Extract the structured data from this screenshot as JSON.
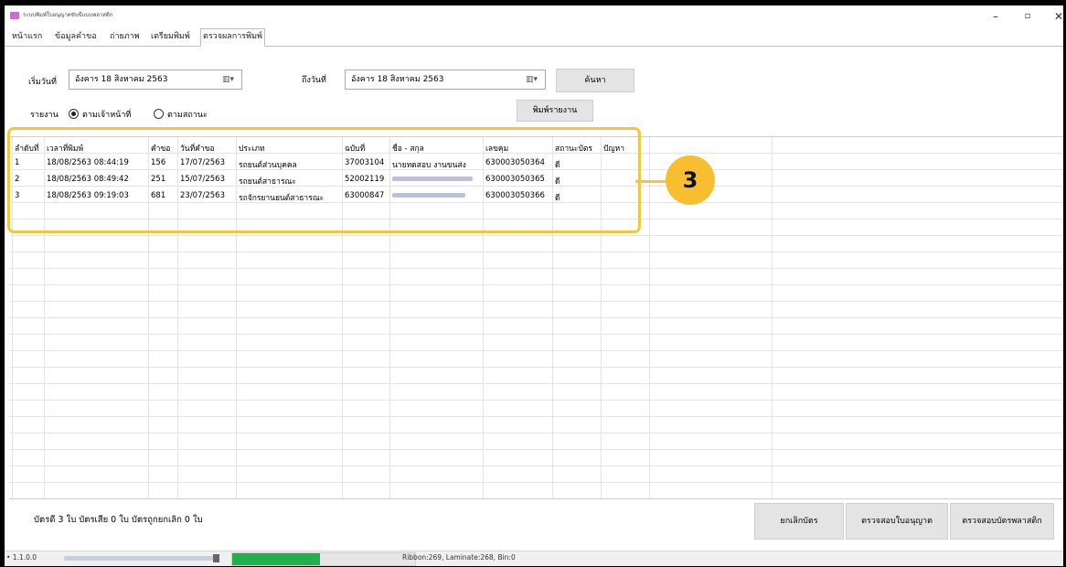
{
  "window": {
    "title": "ระบบพิมพ์ใบอนุญาตขับขี่แบบพลาสติก",
    "controls": {
      "minimize": "–",
      "maximize": "▫",
      "close": "✕"
    }
  },
  "tabs": [
    {
      "label": "หน้าแรก"
    },
    {
      "label": "ข้อมูลคำขอ"
    },
    {
      "label": "ถ่ายภาพ"
    },
    {
      "label": "เตรียมพิมพ์"
    },
    {
      "label": "ตรวจผลการพิมพ์",
      "active": true
    }
  ],
  "filters": {
    "start_label": "เริ่มวันที่",
    "start_date": "อังคาร  18  สิงหาคม    2563",
    "end_label": "ถึงวันที่",
    "end_date": "อังคาร  18  สิงหาคม    2563",
    "calendar_glyph": "▥▾",
    "search_button": "ค้นหา",
    "report_label": "รายงาน",
    "radio_officer": "ตามเจ้าหน้าที่",
    "radio_status": "ตามสถานะ",
    "selected_radio": "officer",
    "print_report_button": "พิมพ์รายงาน"
  },
  "table": {
    "columns": [
      "ลำดับที่",
      "เวลาที่พิมพ์",
      "คำขอ",
      "วันที่คำขอ",
      "ประเภท",
      "ฉบับที่",
      "ชื่อ - สกุล",
      "เลขคุม",
      "สถานะบัตร",
      "ปัญหา"
    ],
    "rows": [
      [
        "1",
        "18/08/2563 08:44:19",
        "156",
        "17/07/2563",
        "รถยนต์ส่วนบุคคล",
        "37003104",
        "นายทดสอบ งานขนส่ง",
        "630003050364",
        "ดี",
        ""
      ],
      [
        "2",
        "18/08/2563 08:49:42",
        "251",
        "15/07/2563",
        "รถยนต์สาธารณะ",
        "52002119",
        "",
        "630003050365",
        "ดี",
        ""
      ],
      [
        "3",
        "18/08/2563 09:19:03",
        "681",
        "23/07/2563",
        "รถจักรยานยนต์สาธารณะ",
        "63000847",
        "",
        "630003050366",
        "ดี",
        ""
      ]
    ]
  },
  "annotation": {
    "number": "3",
    "color": "#F3C641"
  },
  "summary": "บัตรดี 3 ใบ บัตรเสีย 0 ใบ  บัตรถูกยกเลิก 0 ใบ",
  "actions": {
    "cancel_card": "ยกเลิกบัตร",
    "check_license": "ตรวจสอบใบอนุญาต",
    "check_plastic_card": "ตรวจสอบบัตรพลาสติก"
  },
  "status_bar": {
    "version": "• 1.1.0.0",
    "progress_fraction": 0.48,
    "progress_color": "#1FB14B",
    "counters": "Ribbon:269, Laminate:268, Bin:0"
  }
}
